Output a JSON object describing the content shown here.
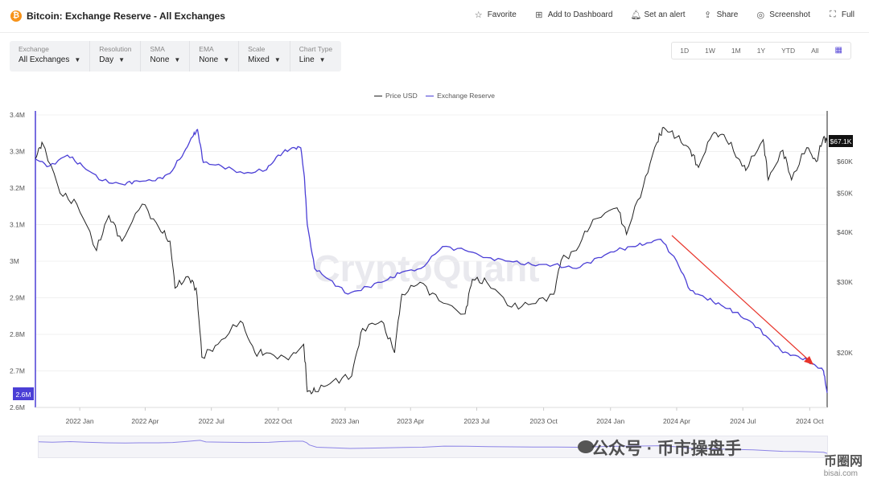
{
  "header": {
    "coin_glyph": "₿",
    "title": "Bitcoin: Exchange Reserve - All Exchanges",
    "actions": [
      {
        "icon": "star-icon",
        "glyph": "☆",
        "label": "Favorite"
      },
      {
        "icon": "dashboard-add-icon",
        "glyph": "⊞",
        "label": "Add to Dashboard"
      },
      {
        "icon": "bell-icon",
        "glyph": "🔔︎",
        "label": "Set an alert"
      },
      {
        "icon": "share-icon",
        "glyph": "⇪",
        "label": "Share"
      },
      {
        "icon": "camera-icon",
        "glyph": "◎",
        "label": "Screenshot"
      },
      {
        "icon": "fullscreen-icon",
        "glyph": "⛶",
        "label": "Full"
      }
    ]
  },
  "controls": [
    {
      "label": "Exchange",
      "value": "All Exchanges"
    },
    {
      "label": "Resolution",
      "value": "Day"
    },
    {
      "label": "SMA",
      "value": "None"
    },
    {
      "label": "EMA",
      "value": "None"
    },
    {
      "label": "Scale",
      "value": "Mixed"
    },
    {
      "label": "Chart Type",
      "value": "Line"
    }
  ],
  "ranges": [
    "1D",
    "1W",
    "1M",
    "1Y",
    "YTD",
    "All"
  ],
  "calendar_icon": "calendar-icon",
  "chart_data": {
    "type": "line",
    "title": "",
    "legend": [
      {
        "name": "Price USD",
        "color": "#222222"
      },
      {
        "name": "Exchange Reserve",
        "color": "#4b3fd6"
      }
    ],
    "legend_placement": "top-center",
    "x_ticks": [
      "2022 Jan",
      "2022 Apr",
      "2022 Jul",
      "2022 Oct",
      "2023 Jan",
      "2023 Apr",
      "2023 Jul",
      "2023 Oct",
      "2024 Jan",
      "2024 Apr",
      "2024 Jul",
      "2024 Oct"
    ],
    "x_range": [
      "2021-11-01",
      "2024-10-25"
    ],
    "y_left": {
      "ticks": [
        "2.6M",
        "2.7M",
        "2.8M",
        "2.9M",
        "3M",
        "3.1M",
        "3.2M",
        "3.3M",
        "3.4M"
      ],
      "ylim": [
        2.6,
        3.4
      ],
      "unit": "M BTC"
    },
    "y_right": {
      "ticks": [
        "$20K",
        "$30K",
        "$40K",
        "$50K",
        "$60K"
      ],
      "values": [
        20000,
        30000,
        40000,
        50000,
        60000
      ],
      "scale": "log"
    },
    "last_labels": {
      "reserve": "2.6M",
      "price": "$67.1K"
    },
    "series": [
      {
        "name": "Exchange Reserve",
        "axis": "left",
        "x": [
          "2021-11-01",
          "2021-11-20",
          "2021-12-15",
          "2022-01-05",
          "2022-02-01",
          "2022-03-01",
          "2022-03-20",
          "2022-04-15",
          "2022-05-05",
          "2022-05-25",
          "2022-06-05",
          "2022-06-12",
          "2022-06-20",
          "2022-07-15",
          "2022-08-15",
          "2022-09-15",
          "2022-10-01",
          "2022-10-20",
          "2022-11-01",
          "2022-11-06",
          "2022-11-10",
          "2022-11-20",
          "2022-12-10",
          "2023-01-05",
          "2023-02-01",
          "2023-03-01",
          "2023-03-20",
          "2023-04-15",
          "2023-05-15",
          "2023-06-15",
          "2023-07-15",
          "2023-08-15",
          "2023-09-15",
          "2023-10-15",
          "2023-11-15",
          "2023-12-15",
          "2024-01-10",
          "2024-02-01",
          "2024-02-20",
          "2024-03-10",
          "2024-04-01",
          "2024-04-20",
          "2024-05-10",
          "2024-06-01",
          "2024-06-20",
          "2024-07-15",
          "2024-08-05",
          "2024-08-25",
          "2024-09-15",
          "2024-10-05",
          "2024-10-20",
          "2024-10-25"
        ],
        "values": [
          3.28,
          3.26,
          3.29,
          3.26,
          3.22,
          3.21,
          3.22,
          3.22,
          3.24,
          3.3,
          3.34,
          3.36,
          3.27,
          3.26,
          3.24,
          3.25,
          3.29,
          3.31,
          3.31,
          3.23,
          3.1,
          2.98,
          2.95,
          2.91,
          2.93,
          2.95,
          2.97,
          2.98,
          3.04,
          3.03,
          3.01,
          3.0,
          2.99,
          2.99,
          2.98,
          3.01,
          3.03,
          3.04,
          3.05,
          3.06,
          3.0,
          2.92,
          2.9,
          2.88,
          2.86,
          2.83,
          2.79,
          2.75,
          2.74,
          2.72,
          2.7,
          2.64
        ]
      },
      {
        "name": "Price USD",
        "axis": "right",
        "x": [
          "2021-11-01",
          "2021-11-10",
          "2021-12-05",
          "2021-12-28",
          "2022-01-24",
          "2022-02-10",
          "2022-02-28",
          "2022-03-28",
          "2022-04-20",
          "2022-05-05",
          "2022-05-12",
          "2022-05-30",
          "2022-06-10",
          "2022-06-18",
          "2022-07-10",
          "2022-08-10",
          "2022-08-30",
          "2022-09-15",
          "2022-10-15",
          "2022-11-05",
          "2022-11-10",
          "2022-11-21",
          "2022-12-15",
          "2023-01-10",
          "2023-01-25",
          "2023-02-20",
          "2023-03-10",
          "2023-03-20",
          "2023-04-14",
          "2023-05-10",
          "2023-06-15",
          "2023-06-25",
          "2023-07-15",
          "2023-08-18",
          "2023-09-15",
          "2023-10-15",
          "2023-10-25",
          "2023-11-15",
          "2023-12-08",
          "2024-01-10",
          "2024-01-23",
          "2024-02-15",
          "2024-03-05",
          "2024-03-14",
          "2024-04-01",
          "2024-04-20",
          "2024-05-01",
          "2024-05-20",
          "2024-06-05",
          "2024-06-25",
          "2024-07-05",
          "2024-07-29",
          "2024-08-05",
          "2024-08-25",
          "2024-09-06",
          "2024-09-27",
          "2024-10-10",
          "2024-10-20",
          "2024-10-25"
        ],
        "values": [
          61000,
          67000,
          50000,
          47000,
          36000,
          44000,
          38000,
          47000,
          41000,
          38000,
          29000,
          31000,
          29000,
          19500,
          21000,
          24000,
          20000,
          20000,
          19200,
          21000,
          16000,
          16000,
          17000,
          17500,
          23000,
          24000,
          20000,
          28000,
          30000,
          27000,
          25000,
          30500,
          30000,
          26000,
          26500,
          28000,
          34000,
          36000,
          43000,
          46000,
          39500,
          52000,
          67000,
          73000,
          69000,
          64000,
          58000,
          70000,
          70000,
          61000,
          57000,
          68000,
          54000,
          64000,
          54000,
          65000,
          60000,
          69000,
          67100
        ]
      }
    ]
  },
  "watermark": {
    "logo_text": "CryptoQuant",
    "wechat_text": "公众号 · 币市操盘手",
    "site_text": "币圈网",
    "site_sub": "bisai.com"
  }
}
